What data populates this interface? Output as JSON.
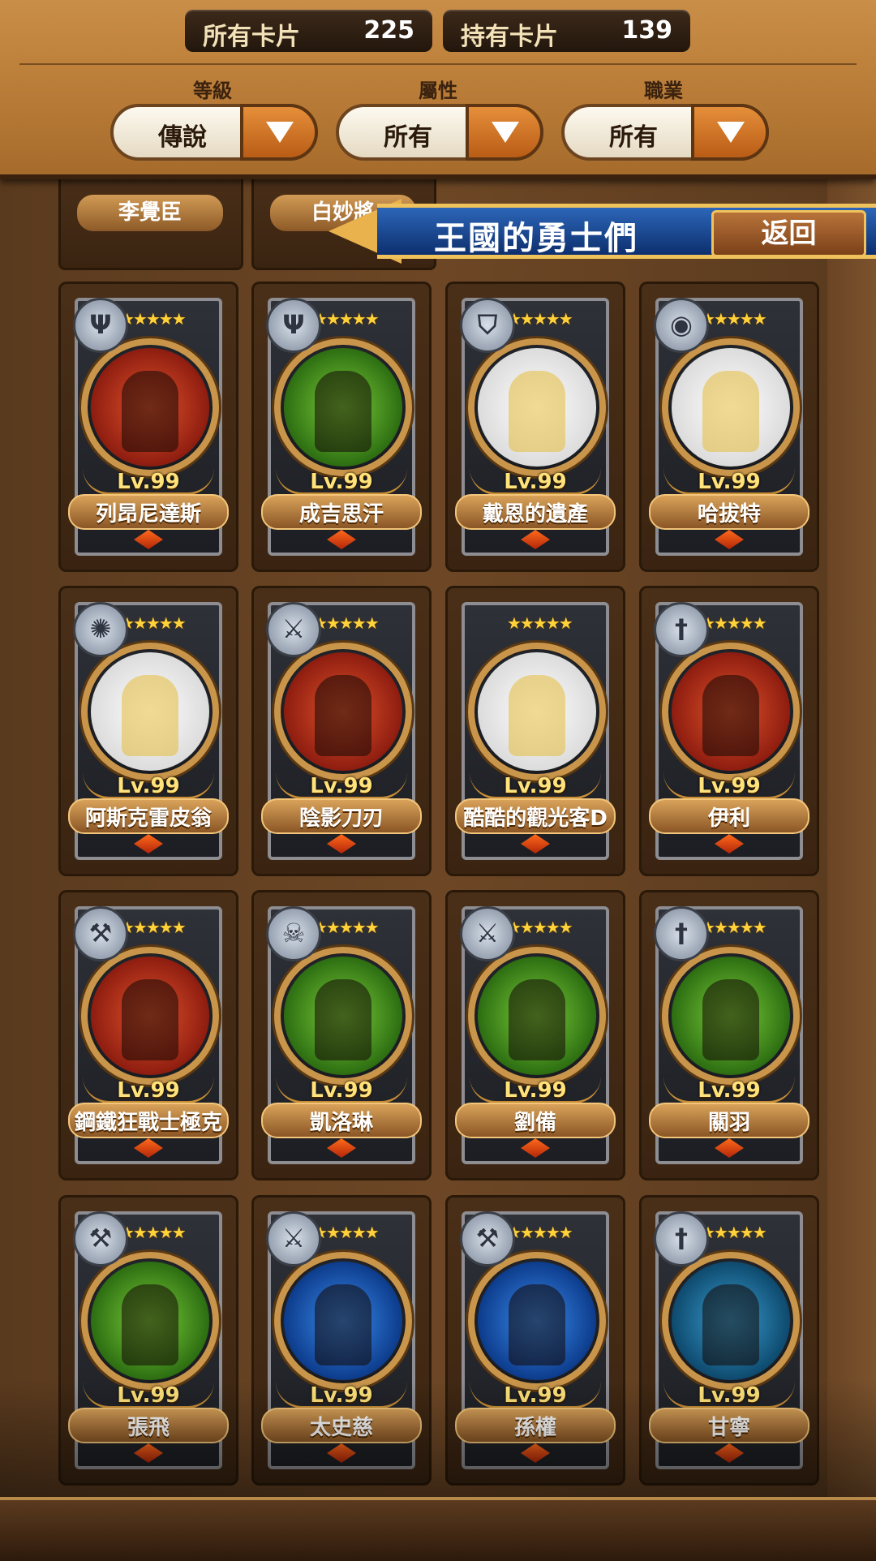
{
  "header": {
    "all_cards_label": "所有卡片",
    "all_cards_value": "225",
    "owned_cards_label": "持有卡片",
    "owned_cards_value": "139",
    "filters": [
      {
        "label": "等級",
        "value": "傳說"
      },
      {
        "label": "屬性",
        "value": "所有"
      },
      {
        "label": "職業",
        "value": "所有"
      }
    ]
  },
  "banner": {
    "title": "王國的勇士們",
    "back_label": "返回"
  },
  "partial_cards": [
    {
      "name": "李覺臣"
    },
    {
      "name": "白妙將"
    }
  ],
  "cards": [
    {
      "name": "列昂尼達斯",
      "level": "Lv.99",
      "stars": "★★★★★",
      "element": "red",
      "emblem": "trident-icon"
    },
    {
      "name": "成吉思汗",
      "level": "Lv.99",
      "stars": "★★★★★",
      "element": "green",
      "emblem": "trident-icon"
    },
    {
      "name": "戴恩的遺產",
      "level": "Lv.99",
      "stars": "★★★★★",
      "element": "white",
      "emblem": "shield-icon"
    },
    {
      "name": "哈拔特",
      "level": "Lv.99",
      "stars": "★★★★★",
      "element": "white",
      "emblem": "orb-icon"
    },
    {
      "name": "阿斯克雷皮翁",
      "level": "Lv.99",
      "stars": "★★★★★",
      "element": "white",
      "emblem": "sun-icon"
    },
    {
      "name": "陰影刀刃",
      "level": "Lv.99",
      "stars": "★★★★★",
      "element": "red",
      "emblem": "crossed-swords-icon"
    },
    {
      "name": "酷酷的觀光客D",
      "level": "Lv.99",
      "stars": "★★★★★",
      "element": "white",
      "emblem": ""
    },
    {
      "name": "伊利",
      "level": "Lv.99",
      "stars": "★★★★★",
      "element": "red",
      "emblem": "sword-icon"
    },
    {
      "name": "鋼鐵狂戰士極克",
      "level": "Lv.99",
      "stars": "★★★★★",
      "element": "red",
      "emblem": "axe-icon"
    },
    {
      "name": "凱洛琳",
      "level": "Lv.99",
      "stars": "★★★★★",
      "element": "green",
      "emblem": "skull-icon"
    },
    {
      "name": "劉備",
      "level": "Lv.99",
      "stars": "★★★★★",
      "element": "green",
      "emblem": "crossed-swords-icon"
    },
    {
      "name": "關羽",
      "level": "Lv.99",
      "stars": "★★★★★",
      "element": "green",
      "emblem": "sword-icon"
    },
    {
      "name": "張飛",
      "level": "Lv.99",
      "stars": "★★★★★",
      "element": "green",
      "emblem": "axe-icon"
    },
    {
      "name": "太史慈",
      "level": "Lv.99",
      "stars": "★★★★★",
      "element": "blue",
      "emblem": "crossed-swords-icon"
    },
    {
      "name": "孫權",
      "level": "Lv.99",
      "stars": "★★★★★",
      "element": "blue",
      "emblem": "axe-icon"
    },
    {
      "name": "甘寧",
      "level": "Lv.99",
      "stars": "★★★★★",
      "element": "teal",
      "emblem": "sword-icon"
    }
  ]
}
